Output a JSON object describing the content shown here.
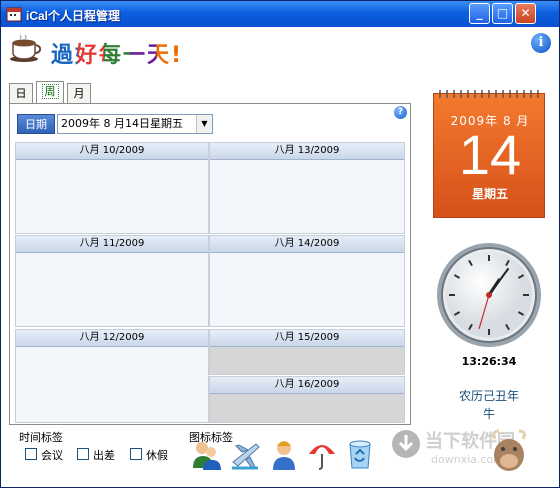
{
  "window": {
    "title": "iCal个人日程管理",
    "controls": {
      "minimize": "_",
      "maximize": "□",
      "close": "✕"
    }
  },
  "header": {
    "slogan": "過好每一天!",
    "info_icon": "i"
  },
  "tabs": [
    {
      "label": "日",
      "active": false
    },
    {
      "label": "周",
      "active": true
    },
    {
      "label": "月",
      "active": false
    }
  ],
  "date_picker": {
    "label": "日期",
    "value": "2009年 8 月14日星期五"
  },
  "help_icon": "?",
  "week_days": [
    {
      "label": "八月 10/2009"
    },
    {
      "label": "八月 13/2009"
    },
    {
      "label": "八月 11/2009"
    },
    {
      "label": "八月 14/2009"
    },
    {
      "label": "八月 12/2009"
    },
    {
      "label": "八月 15/2009"
    },
    {
      "label": "八月 16/2009"
    }
  ],
  "time_tags": {
    "title": "时间标签",
    "items": [
      {
        "label": "会议",
        "checked": false
      },
      {
        "label": "出差",
        "checked": false
      },
      {
        "label": "休假",
        "checked": false
      }
    ]
  },
  "icon_tags": {
    "title": "图标标签",
    "icons": [
      "users-icon",
      "airplane-icon",
      "person-icon",
      "umbrella-icon",
      "recycle-bin-icon"
    ]
  },
  "calendar": {
    "year_month": "2009年 8 月",
    "day": "14",
    "weekday": "星期五"
  },
  "clock": {
    "time": "13:26:34"
  },
  "lunar": {
    "line1": "农历己丑年",
    "line2": "牛"
  },
  "watermark": {
    "text": "当下软件园",
    "sub": "downxia.com"
  },
  "colors": {
    "title_bar": "#0b5fe0",
    "calendar_orange": "#e8601f",
    "tab_active_text": "#006400",
    "lunar_text": "#1b4f7a"
  }
}
